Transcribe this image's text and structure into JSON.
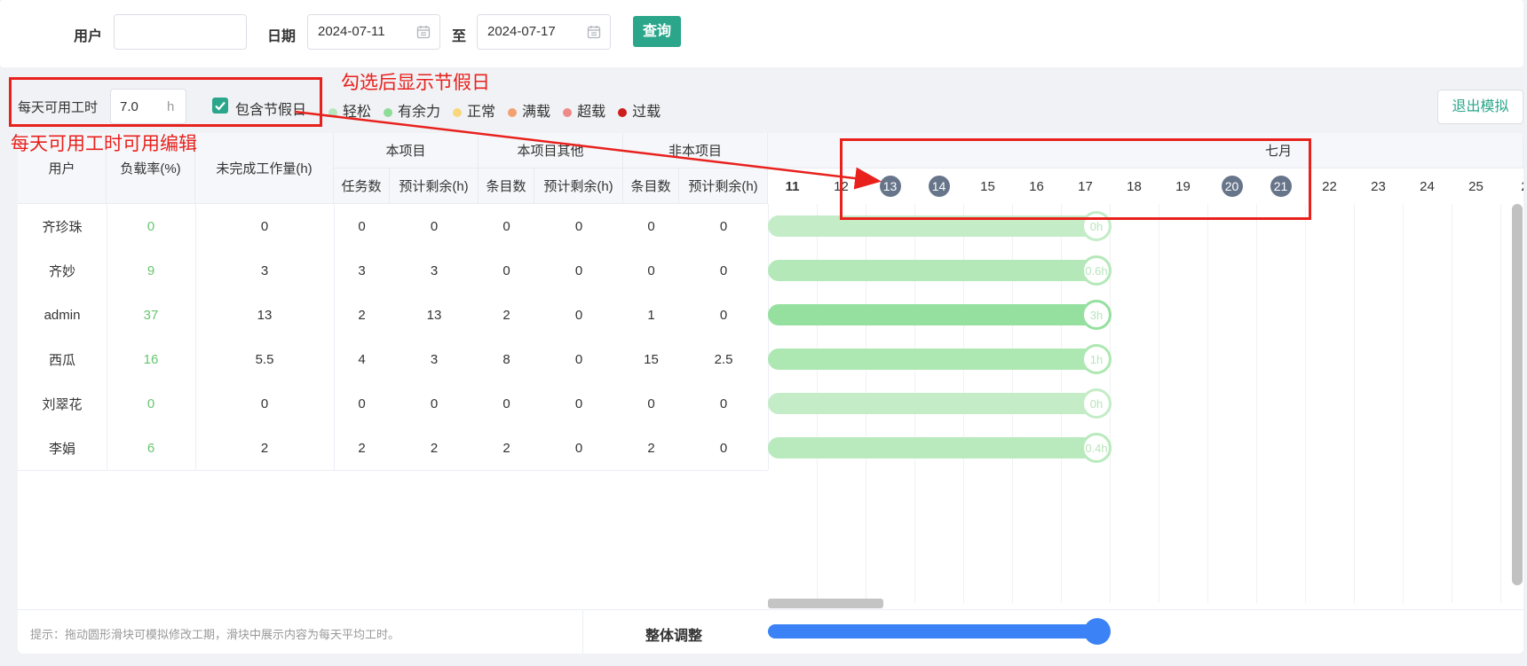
{
  "filter": {
    "user_label": "用户",
    "user_value": "",
    "date_label": "日期",
    "date_start": "2024-07-11",
    "range_sep": "至",
    "date_end": "2024-07-17",
    "query_label": "查询"
  },
  "hours": {
    "label": "每天可用工时",
    "value": "7.0",
    "unit": "h",
    "holiday_label": "包含节假日",
    "holiday_checked": true
  },
  "legend": [
    {
      "label": "轻松",
      "color": "#b7e8bd"
    },
    {
      "label": "有余力",
      "color": "#8fdc98"
    },
    {
      "label": "正常",
      "color": "#f9d77d"
    },
    {
      "label": "满载",
      "color": "#f2a170"
    },
    {
      "label": "超载",
      "color": "#ef8a8a"
    },
    {
      "label": "过载",
      "color": "#cc1c1c"
    }
  ],
  "exit_label": "退出模拟",
  "table": {
    "headers": {
      "user": "用户",
      "load": "负载率(%)",
      "pending": "未完成工作量(h)",
      "this_project": "本项目",
      "task_count": "任务数",
      "est_remain": "预计剩余(h)",
      "this_other": "本项目其他",
      "item_count": "条目数",
      "est_remain2": "预计剩余(h)",
      "non_project": "非本项目",
      "item_count2": "条目数",
      "est_remain3": "预计剩余(h)"
    },
    "rows": [
      {
        "user": "齐珍珠",
        "load": "0",
        "pending": "0",
        "tasks": "0",
        "task_remain": "0",
        "other_items": "0",
        "other_remain": "0",
        "non_items": "0",
        "non_remain": "0",
        "handle": "0h",
        "bar_color": "#c3ecc7"
      },
      {
        "user": "齐妙",
        "load": "9",
        "pending": "3",
        "tasks": "3",
        "task_remain": "3",
        "other_items": "0",
        "other_remain": "0",
        "non_items": "0",
        "non_remain": "0",
        "handle": "0.6h",
        "bar_color": "#b4e8b9"
      },
      {
        "user": "admin",
        "load": "37",
        "pending": "13",
        "tasks": "2",
        "task_remain": "13",
        "other_items": "2",
        "other_remain": "0",
        "non_items": "1",
        "non_remain": "0",
        "handle": "3h",
        "bar_color": "#95e09f"
      },
      {
        "user": "西瓜",
        "load": "16",
        "pending": "5.5",
        "tasks": "4",
        "task_remain": "3",
        "other_items": "8",
        "other_remain": "0",
        "non_items": "15",
        "non_remain": "2.5",
        "handle": "1h",
        "bar_color": "#ade8b3"
      },
      {
        "user": "刘翠花",
        "load": "0",
        "pending": "0",
        "tasks": "0",
        "task_remain": "0",
        "other_items": "0",
        "other_remain": "0",
        "non_items": "0",
        "non_remain": "0",
        "handle": "0h",
        "bar_color": "#c3ecc7"
      },
      {
        "user": "李娟",
        "load": "6",
        "pending": "2",
        "tasks": "2",
        "task_remain": "2",
        "other_items": "2",
        "other_remain": "0",
        "non_items": "2",
        "non_remain": "0",
        "handle": "0.4h",
        "bar_color": "#b9eabd"
      }
    ]
  },
  "calendar": {
    "month": "七月",
    "days": [
      {
        "d": "11",
        "bold": true,
        "holiday": false
      },
      {
        "d": "12",
        "holiday": false
      },
      {
        "d": "13",
        "holiday": true
      },
      {
        "d": "14",
        "holiday": true
      },
      {
        "d": "15",
        "holiday": false
      },
      {
        "d": "16",
        "holiday": false
      },
      {
        "d": "17",
        "holiday": false
      },
      {
        "d": "18",
        "holiday": false
      },
      {
        "d": "19",
        "holiday": false
      },
      {
        "d": "20",
        "holiday": true
      },
      {
        "d": "21",
        "holiday": true
      },
      {
        "d": "22",
        "holiday": false
      },
      {
        "d": "23",
        "holiday": false
      },
      {
        "d": "24",
        "holiday": false
      },
      {
        "d": "25",
        "holiday": false
      },
      {
        "d": "2",
        "holiday": false
      }
    ]
  },
  "footer": {
    "tip": "提示：拖动圆形滑块可模拟修改工期，滑块中展示内容为每天平均工时。",
    "adjust_label": "整体调整",
    "slider_color": "#3b82f6"
  },
  "annotations": {
    "holiday_note": "勾选后显示节假日",
    "hours_note": "每天可用工时可用编辑"
  }
}
